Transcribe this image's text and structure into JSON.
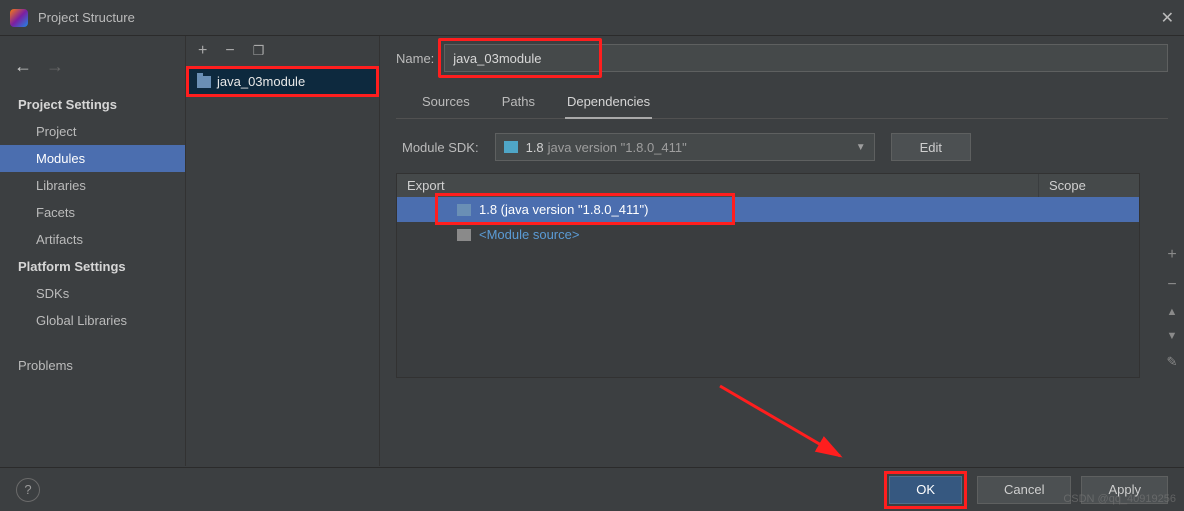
{
  "window": {
    "title": "Project Structure"
  },
  "nav": {
    "projectSettings": "Project Settings",
    "items1": [
      "Project",
      "Modules",
      "Libraries",
      "Facets",
      "Artifacts"
    ],
    "platformSettings": "Platform Settings",
    "items2": [
      "SDKs",
      "Global Libraries"
    ],
    "problems": "Problems",
    "selected": "Modules"
  },
  "modules": {
    "items": [
      "java_03module"
    ]
  },
  "content": {
    "nameLabel": "Name:",
    "nameValue": "java_03module",
    "tabs": [
      "Sources",
      "Paths",
      "Dependencies"
    ],
    "activeTab": "Dependencies",
    "sdkLabel": "Module SDK:",
    "sdkVersion": "1.8",
    "sdkDetail": "java version \"1.8.0_411\"",
    "editLabel": "Edit",
    "columns": {
      "export": "Export",
      "scope": "Scope"
    },
    "rows": [
      {
        "label": "1.8 (java version \"1.8.0_411\")",
        "selected": true
      },
      {
        "label": "<Module source>",
        "link": true
      }
    ]
  },
  "footer": {
    "ok": "OK",
    "cancel": "Cancel",
    "apply": "Apply"
  },
  "watermark": "CSDN @qq_40919256"
}
